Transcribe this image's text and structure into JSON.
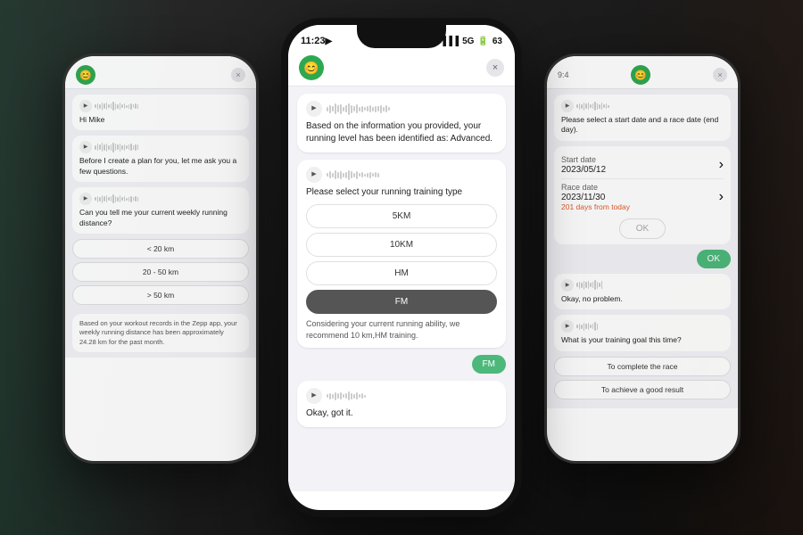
{
  "background": {
    "color": "#1a1a1a"
  },
  "left_phone": {
    "header": {
      "avatar_icon": "😊",
      "close_icon": "×"
    },
    "messages": [
      {
        "type": "bot",
        "text": "Hi Mike"
      },
      {
        "type": "bot",
        "text": "Before I create a plan for you, let me ask you a few questions."
      },
      {
        "type": "bot",
        "text": "Can you tell me your current weekly running distance?"
      },
      {
        "type": "choices",
        "options": [
          "< 20 km",
          "20 - 50 km",
          "> 50 km"
        ]
      },
      {
        "type": "info",
        "text": "Based on your workout records in the Zepp app, your weekly running distance has been approximately 24.28 km for the past month."
      }
    ]
  },
  "center_phone": {
    "status_bar": {
      "time": "11:23",
      "arrow_icon": "▶",
      "signal_icon": "5G",
      "battery_label": "63"
    },
    "header": {
      "avatar_icon": "😊",
      "close_icon": "×"
    },
    "messages": [
      {
        "type": "bot",
        "text": "Based on the information you provided, your running level has been identified as: Advanced."
      },
      {
        "type": "bot",
        "text": "Please select your running training type"
      },
      {
        "type": "choices",
        "options": [
          "5KM",
          "10KM",
          "HM",
          "FM"
        ],
        "selected": "FM"
      },
      {
        "type": "info",
        "text": "Considering your current running ability, we recommend 10 km,HM training."
      },
      {
        "type": "user",
        "text": "FM"
      },
      {
        "type": "bot",
        "text": "Okay, got it."
      }
    ]
  },
  "right_phone": {
    "status_bar": {
      "time": "9:4"
    },
    "header": {
      "avatar_icon": "😊",
      "close_icon": "×"
    },
    "messages": [
      {
        "type": "bot",
        "text": "Please select a start date and a race date (end day)."
      },
      {
        "type": "date_picker",
        "start_label": "Start date",
        "start_value": "2023/05/12",
        "race_label": "Race date",
        "race_value": "2023/11/30",
        "race_sub": "201 days from today"
      },
      {
        "type": "ok_inactive",
        "label": "OK"
      },
      {
        "type": "user",
        "text": "OK"
      },
      {
        "type": "bot",
        "text": "Okay, no problem."
      },
      {
        "type": "bot",
        "text": "What is your training goal this time?"
      },
      {
        "type": "choices",
        "options": [
          "To complete the race",
          "To achieve a good result"
        ]
      }
    ]
  }
}
